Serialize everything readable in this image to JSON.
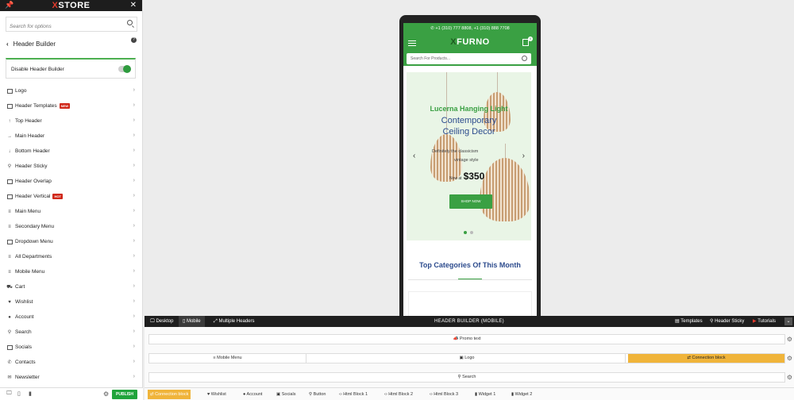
{
  "sidebar": {
    "brand_x": "X",
    "brand_rest": "STORE",
    "search_placeholder": "Search for options",
    "title": "Header Builder",
    "disable_label": "Disable Header Builder",
    "disable_on": true,
    "items": [
      {
        "label": "Logo",
        "badge": ""
      },
      {
        "label": "Header Templates",
        "badge": "NEW"
      },
      {
        "label": "Top Header",
        "badge": ""
      },
      {
        "label": "Main Header",
        "badge": ""
      },
      {
        "label": "Bottom Header",
        "badge": ""
      },
      {
        "label": "Header Sticky",
        "badge": ""
      },
      {
        "label": "Header Overlap",
        "badge": ""
      },
      {
        "label": "Header Vertical",
        "badge": "HOT"
      },
      {
        "label": "Main Menu",
        "badge": ""
      },
      {
        "label": "Secondary Menu",
        "badge": ""
      },
      {
        "label": "Dropdown Menu",
        "badge": ""
      },
      {
        "label": "All Departments",
        "badge": ""
      },
      {
        "label": "Mobile Menu",
        "badge": ""
      },
      {
        "label": "Cart",
        "badge": ""
      },
      {
        "label": "Wishlist",
        "badge": ""
      },
      {
        "label": "Account",
        "badge": ""
      },
      {
        "label": "Search",
        "badge": ""
      },
      {
        "label": "Socials",
        "badge": ""
      },
      {
        "label": "Contacts",
        "badge": ""
      },
      {
        "label": "Newsletter",
        "badge": ""
      }
    ],
    "publish_label": "PUBLISH"
  },
  "preview": {
    "topbar": "+1 (310) 777 8808, +1 (310) 888 7708",
    "brand_x": "X",
    "brand_rest": "FURNO",
    "cart_count": "0",
    "search_placeholder": "Search For Products...",
    "hero": {
      "title": "Lucerna Hanging Light",
      "subtitle_1": "Contemporary",
      "subtitle_2": "Ceiling Decor",
      "line_1": "Definitely the classicism",
      "line_2": "vintage style",
      "price_prefix": "Now at",
      "price": "$350",
      "button": "SHOP NOW"
    },
    "categories_title": "Top Categories Of This Month"
  },
  "builder": {
    "tabs": {
      "desktop": "Desktop",
      "mobile": "Mobile",
      "multiple": "Multiple Headers"
    },
    "title": "HEADER BUILDER (MOBILE)",
    "right": {
      "templates": "Templates",
      "sticky": "Header Sticky",
      "tutorials": "Tutorials"
    },
    "rows": {
      "promo": "Promo text",
      "mobile_menu": "Mobile Menu",
      "logo": "Logo",
      "connection": "Connection block",
      "search": "Search"
    },
    "chips": [
      "Connection block",
      "Wishlist",
      "Account",
      "Socials",
      "Button",
      "Html Block 1",
      "Html Block 2",
      "Html Block 3",
      "Widget 1",
      "Widget 2"
    ]
  }
}
